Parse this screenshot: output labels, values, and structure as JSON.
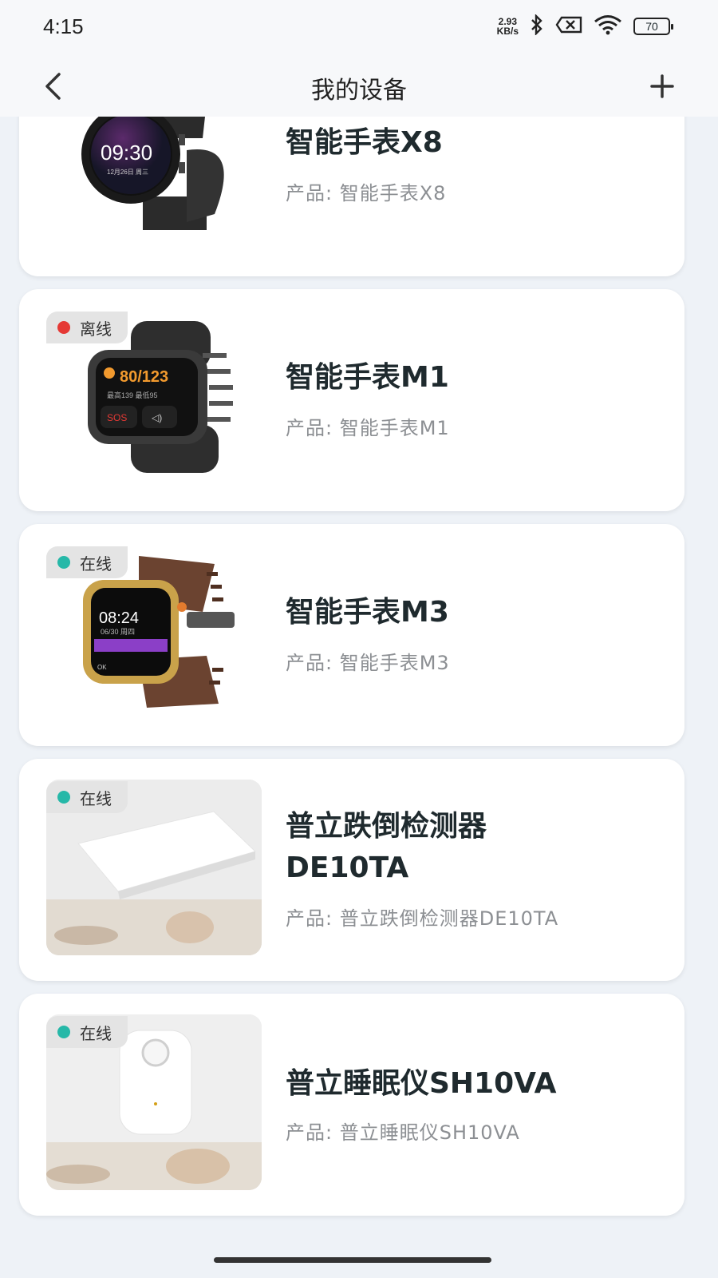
{
  "status_bar": {
    "time": "4:15",
    "net_speed_value": "2.93",
    "net_speed_unit": "KB/s",
    "battery": "70"
  },
  "header": {
    "title": "我的设备",
    "back_icon": "chevron-left-icon",
    "add_icon": "plus-icon"
  },
  "devices": [
    {
      "name": "智能手表X8",
      "product": "产品: 智能手表X8",
      "status": "",
      "image": "round-smartwatch"
    },
    {
      "name": "智能手表M1",
      "product": "产品: 智能手表M1",
      "status": "离线",
      "status_color": "#e53935",
      "image": "square-smartwatch-black"
    },
    {
      "name": "智能手表M3",
      "product": "产品: 智能手表M3",
      "status": "在线",
      "status_color": "#26b8a8",
      "image": "square-smartwatch-gold"
    },
    {
      "name": "普立跌倒检测器DE10TA",
      "name_line1": "普立跌倒检测器",
      "name_line2": "DE10TA",
      "product": "产品: 普立跌倒检测器DE10TA",
      "status": "在线",
      "status_color": "#26b8a8",
      "image": "fall-detector-photo"
    },
    {
      "name": "普立睡眠仪SH10VA",
      "product": "产品: 普立睡眠仪SH10VA",
      "status": "在线",
      "status_color": "#26b8a8",
      "image": "sleep-monitor-photo"
    }
  ]
}
